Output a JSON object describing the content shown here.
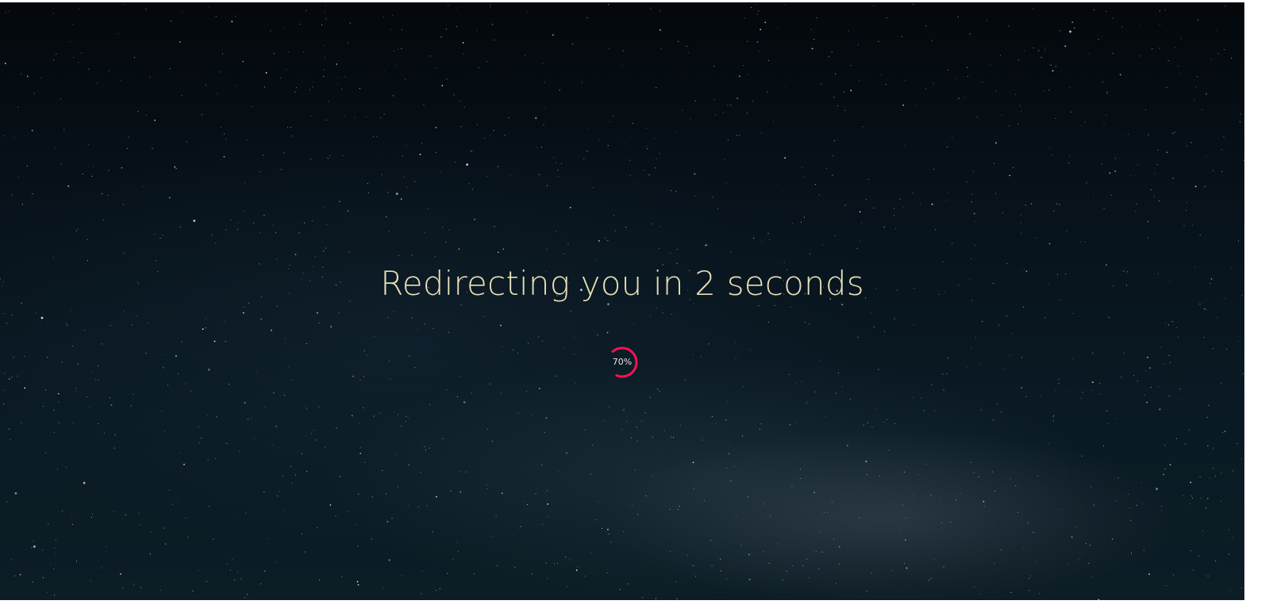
{
  "redirect": {
    "message": "Redirecting you in 2 seconds",
    "progress_label": "70%",
    "progress": 0.7
  },
  "colors": {
    "text": "#e8dfb6",
    "progress_accent": "#ff1053",
    "background": "#07121b"
  }
}
